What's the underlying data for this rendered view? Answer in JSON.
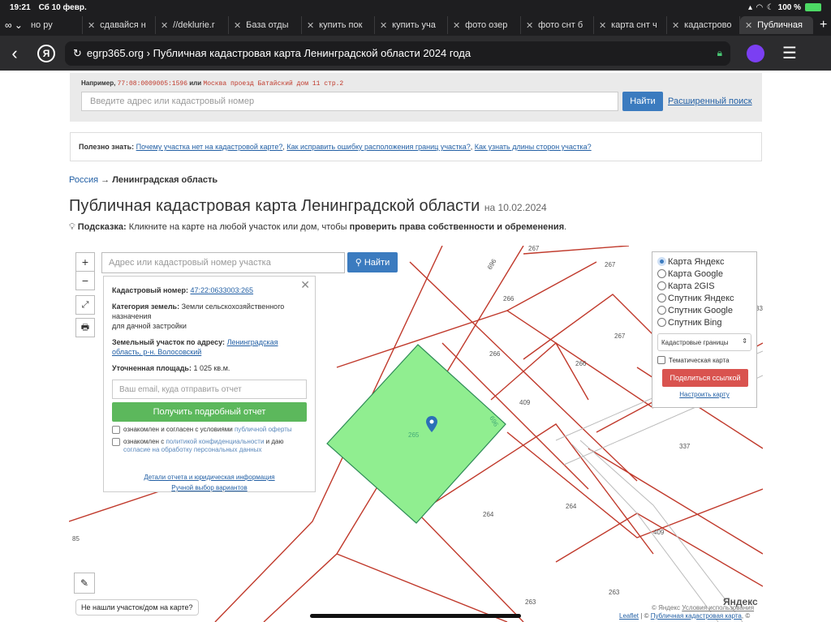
{
  "status": {
    "time": "19:21",
    "date": "Сб 10 февр.",
    "battery": "100 %"
  },
  "tabs": [
    {
      "label": "но ру",
      "active": false
    },
    {
      "label": "сдавайся н",
      "active": false
    },
    {
      "label": "//deklurie.r",
      "active": false
    },
    {
      "label": "База отды",
      "active": false
    },
    {
      "label": "купить пок",
      "active": false
    },
    {
      "label": "купить уча",
      "active": false
    },
    {
      "label": "фото озер",
      "active": false
    },
    {
      "label": "фото снт б",
      "active": false
    },
    {
      "label": "карта снт ч",
      "active": false
    },
    {
      "label": "кадастрово",
      "active": false
    },
    {
      "label": "Публичная",
      "active": true
    }
  ],
  "browser": {
    "url": "egrp365.org › Публичная кадастровая карта Ленинградской области 2024 года"
  },
  "search": {
    "example_label": "Например,",
    "example_code": "77:08:0009005:1596",
    "example_or": "или",
    "example_addr": "Москва проезд Батайский дом 11 стр.2",
    "placeholder": "Введите адрес или кадастровый номер",
    "find_label": "Найти",
    "advanced_label": "Расширенный поиск"
  },
  "useful": {
    "title": "Полезно знать:",
    "link1": "Почему участка нет на кадастровой карте?",
    "link2": "Как исправить ошибку расположения границ участка?",
    "link3": "Как узнать длины сторон участка?"
  },
  "breadcrumb": {
    "root": "Россия",
    "arrow": "→",
    "current": "Ленинградская область"
  },
  "page": {
    "title": "Публичная кадастровая карта Ленинградской области",
    "date": "на 10.02.2024",
    "hint_label": "Подсказка:",
    "hint_text": "Кликните на карте на любой участок или дом, чтобы",
    "hint_bold": "проверить права собственности и обременения",
    "hint_end": "."
  },
  "map": {
    "zoom_in": "+",
    "zoom_out": "−",
    "input_placeholder": "Адрес или кадастровый номер участка",
    "find_label": "Найти",
    "popup": {
      "cad_label": "Кадастровый номер:",
      "cad_value": "47:22:0633003:265",
      "cat_label": "Категория земель:",
      "cat_value": "Земли сельскохозяйственного назначения",
      "cat_value2": "для дачной застройки",
      "addr_label": "Земельный участок по адресу:",
      "addr_value": "Ленинградская область, р-н. Волосовский",
      "area_label": "Уточненная площадь:",
      "area_value": "1 025 кв.м.",
      "email_placeholder": "Ваш email, куда отправить отчет",
      "report_label": "Получить подробный отчет",
      "cb1_text": "ознакомлен и согласен с условиями",
      "cb1_link": "публичной оферты",
      "cb2_text": "ознакомлен с",
      "cb2_link": "политикой конфиденциальности",
      "cb2_mid": "и даю",
      "cb2_link2": "согласие на обработку персональных данных",
      "details_link": "Детали отчета и юридическая информация",
      "manual_link": "Ручной выбор вариантов"
    },
    "layers": {
      "options": [
        "Карта Яндекс",
        "Карта Google",
        "Карта 2GIS",
        "Спутник Яндекс",
        "Спутник Google",
        "Спутник Bing"
      ],
      "selected": 0,
      "select_value": "Кадастровые границы",
      "thematic": "Тематическая карта",
      "share": "Поделиться ссылкой",
      "setup": "Настроить карту"
    },
    "labels": {
      "l267a": "267",
      "l696": "696",
      "l267b": "267",
      "l266a": "266",
      "l267c": "267",
      "l266b": "266",
      "l266c": "266",
      "l409a": "409",
      "l265": "265",
      "l696b": "696",
      "l337": "337",
      "l264a": "264",
      "l264b": "264",
      "l409b": "409",
      "l263a": "263",
      "l263b": "263",
      "l85": "85",
      "l33": "33"
    },
    "not_found": "Не нашли участок/дом на карте?",
    "yandex_logo": "Яндекс",
    "credits_a": "© Яндекс",
    "credits_b": "Условия использования",
    "credits_leaflet": "Leaflet",
    "credits_sep": "| ©",
    "credits_pkk": "Публичная кадастровая карта",
    "credits_end": ", ©"
  },
  "colors": {
    "parcel": "#90ee90",
    "boundary": "#c0392b",
    "accent": "#3b7bbf"
  }
}
